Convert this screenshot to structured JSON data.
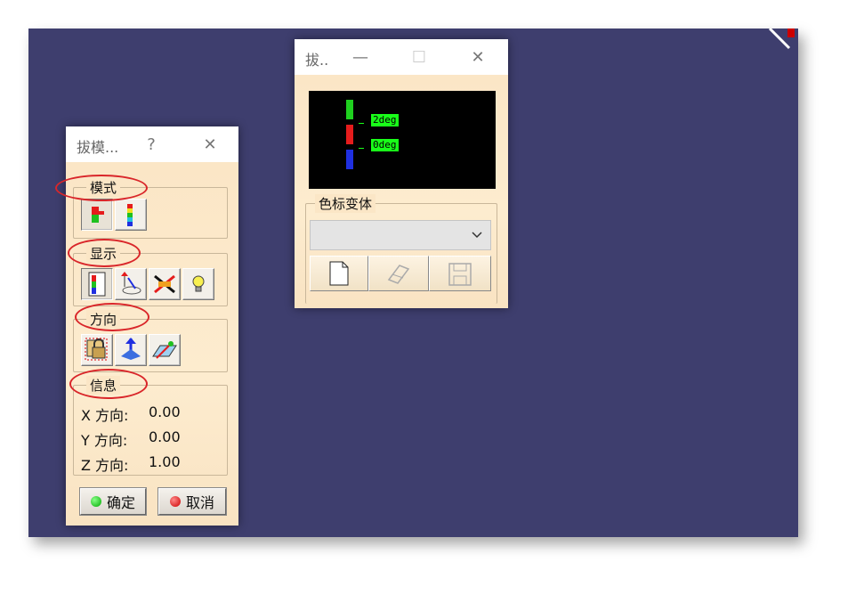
{
  "draft_dialog": {
    "title": "拔模...",
    "help_label": "?",
    "close_label": "✕",
    "groups": {
      "mode": "模式",
      "display": "显示",
      "direction": "方向",
      "info": "信息"
    },
    "info": {
      "x_label": "X 方向:",
      "x_value": "0.00",
      "y_label": "Y 方向:",
      "y_value": "0.00",
      "z_label": "Z 方向:",
      "z_value": "1.00"
    },
    "ok_label": "确定",
    "cancel_label": "取消",
    "icons": {
      "mode": [
        "quick-analysis-icon",
        "full-analysis-icon"
      ],
      "display": [
        "color-scale-icon",
        "on-the-fly-icon",
        "cross-out-icon",
        "light-bulb-icon"
      ],
      "direction": [
        "lock-direction-icon",
        "compass-direction-icon",
        "plane-direction-icon"
      ]
    }
  },
  "color_scale_dialog": {
    "title": "拔..",
    "minimize_label": "—",
    "maximize_label": "☐",
    "close_label": "✕",
    "legend": {
      "values": [
        "2deg",
        "0deg"
      ],
      "colors": [
        "#1fd01f",
        "#e51c1c",
        "#1f2fe0"
      ]
    },
    "variant_group_label": "色标变体",
    "variant_selected": "",
    "buttons": [
      "new-icon",
      "eraser-icon",
      "save-icon"
    ]
  },
  "colors": {
    "viewport_bg": "#3e3e6e",
    "dialog_bg": "#fbe6c6",
    "highlight_ellipse": "#d9262a"
  }
}
